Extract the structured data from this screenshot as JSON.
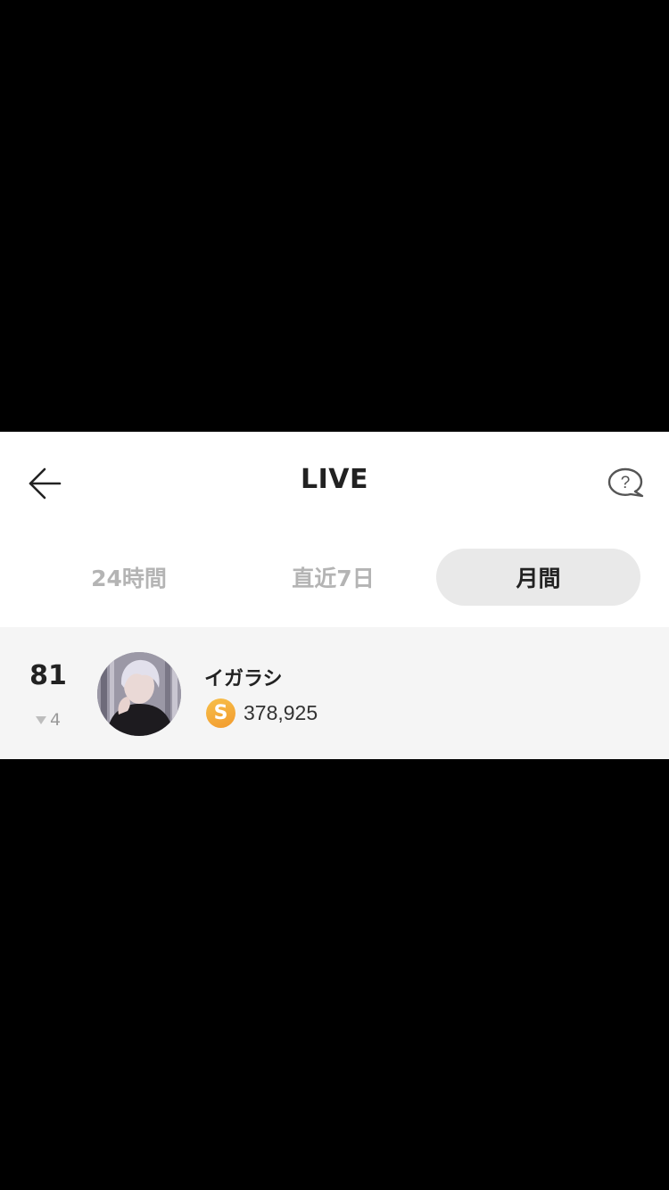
{
  "header": {
    "title": "LIVE",
    "back_icon": "arrow-left-icon",
    "help_icon": "help-bubble-icon"
  },
  "tabs": [
    {
      "label": "24時間",
      "active": false
    },
    {
      "label": "直近7日",
      "active": false
    },
    {
      "label": "月間",
      "active": true
    }
  ],
  "ranking": [
    {
      "rank": "81",
      "change_direction": "down",
      "change": "4",
      "name": "イガラシ",
      "coin_label": "S",
      "score": "378,925",
      "avatar_icon": "user-avatar"
    }
  ],
  "colors": {
    "coin": "#f2a93a",
    "active_tab_bg": "#e9e9e9",
    "row_bg": "#f5f5f5",
    "inactive_tab_text": "#b4b4b4"
  }
}
